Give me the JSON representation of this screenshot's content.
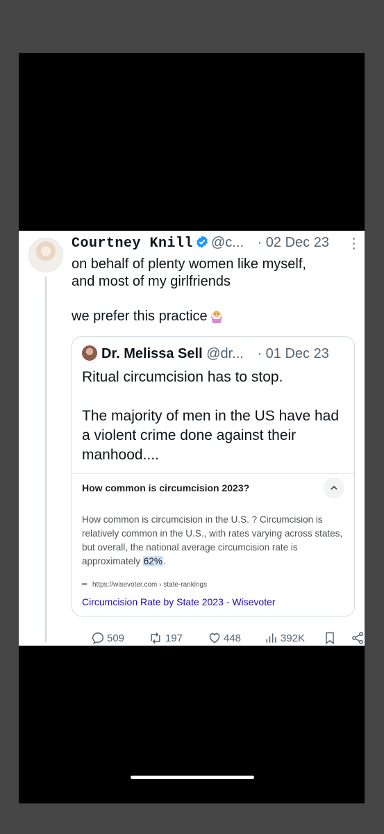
{
  "tweet": {
    "author_name": "Courtney Knill",
    "handle": "@c...",
    "date": "· 02 Dec 23",
    "text": "on behalf of plenty women like myself,\nand most of my girlfriends\n\nwe prefer this practice",
    "emoji_icon": "woman-shrugging-emoji"
  },
  "quote": {
    "author_name": "Dr. Melissa Sell",
    "handle": "@dr...",
    "date": "· 01 Dec 23",
    "text": "Ritual circumcision has to stop.\n\nThe majority of men in the US have had a violent crime done against their manhood....",
    "card": {
      "title": "How common is circumcision 2023?",
      "body_before": "How common is circumcision in the U.S. ? Circumcision is relatively common in the U.S., with rates varying across states, but overall, the national average circumcision rate is approximately ",
      "highlight": "62%",
      "body_after": ".",
      "source": "https://wisevoter.com › state-rankings",
      "link_text": "Circumcision Rate by State 2023 - Wisevoter"
    }
  },
  "actions": {
    "replies": "509",
    "retweets": "197",
    "likes": "448",
    "views": "392K"
  },
  "colors": {
    "verified": "#1d9bf0",
    "link": "#1a0dab",
    "highlight": "#d3e3fd"
  }
}
